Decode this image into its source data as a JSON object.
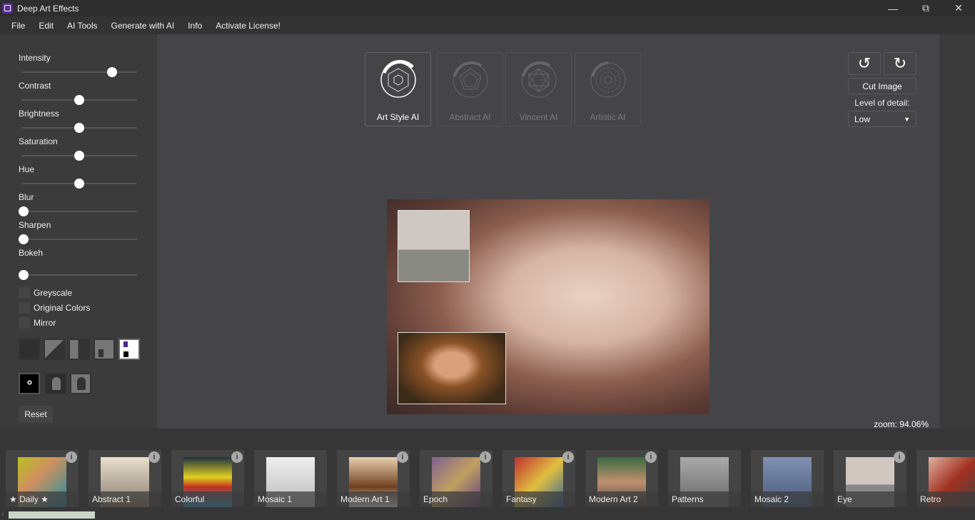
{
  "window": {
    "title": "Deep Art Effects",
    "controls": [
      "minimize",
      "restore",
      "close"
    ]
  },
  "menu": [
    "File",
    "Edit",
    "AI Tools",
    "Generate with AI",
    "Info",
    "Activate License!"
  ],
  "sliders": [
    {
      "label": "Intensity",
      "value": 0.8
    },
    {
      "label": "Contrast",
      "value": 0.5
    },
    {
      "label": "Brightness",
      "value": 0.5
    },
    {
      "label": "Saturation",
      "value": 0.5
    },
    {
      "label": "Hue",
      "value": 0.5
    },
    {
      "label": "Blur",
      "value": 0
    },
    {
      "label": "Sharpen",
      "value": 0
    },
    {
      "label": "Bokeh",
      "value": 0
    }
  ],
  "checkboxes": [
    {
      "label": "Greyscale",
      "checked": false
    },
    {
      "label": "Original Colors",
      "checked": false
    },
    {
      "label": "Mirror",
      "checked": false
    }
  ],
  "reset_label": "Reset",
  "modes": [
    {
      "label": "Art Style AI",
      "active": true
    },
    {
      "label": "Abstract AI",
      "active": false
    },
    {
      "label": "Vincent AI",
      "active": false
    },
    {
      "label": "Artistic AI",
      "active": false
    }
  ],
  "right": {
    "cut_label": "Cut Image",
    "detail_label": "Level of detail:",
    "detail_value": "Low"
  },
  "zoom": "zoom: 94.06%",
  "styles": [
    "★ Daily ★",
    "Abstract 1",
    "Colorful",
    "Mosaic 1",
    "Modern Art 1",
    "Epoch",
    "Fantasy",
    "Modern Art 2",
    "Patterns",
    "Mosaic 2",
    "Eye",
    "Retro"
  ],
  "colors": {
    "accent": "#5a2d91",
    "canvas": "#454547"
  }
}
